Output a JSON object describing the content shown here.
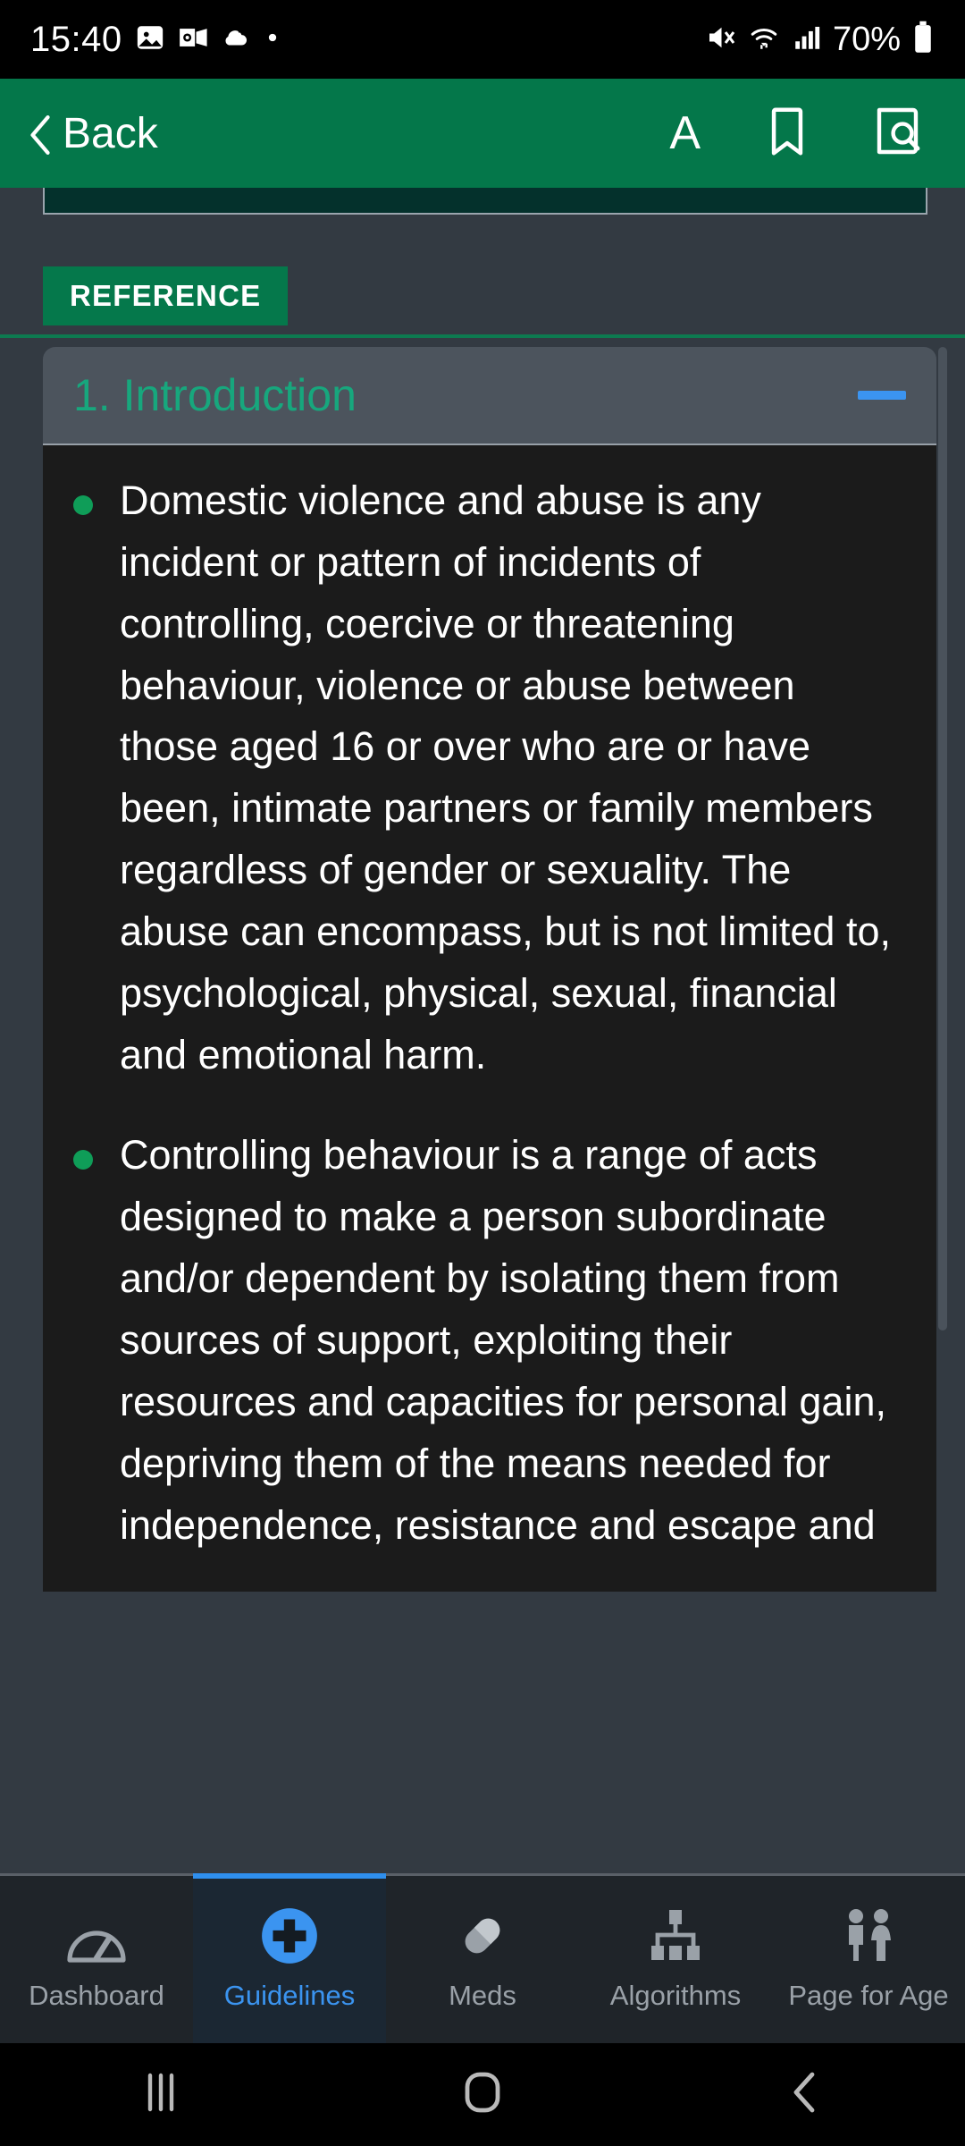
{
  "statusbar": {
    "time": "15:40",
    "battery_percent": "70%",
    "icons": [
      "photo-icon",
      "outlook-icon",
      "cloud-icon",
      "dot-icon"
    ],
    "right_icons": [
      "mute-icon",
      "wifi-icon",
      "signal-icon",
      "battery-icon"
    ]
  },
  "appbar": {
    "back_label": "Back",
    "background_color": "#04774a",
    "actions": [
      {
        "name": "font-size-icon",
        "label": "A"
      },
      {
        "name": "bookmark-icon",
        "label": ""
      },
      {
        "name": "page-search-icon",
        "label": ""
      }
    ]
  },
  "content": {
    "tab_badge": "REFERENCE",
    "accordion": {
      "title": "1. Introduction",
      "state": "expanded",
      "toggle_symbol": "minus",
      "toggle_color": "#3b94f0",
      "title_color": "#17a77d",
      "bullets": [
        "Domestic violence and abuse is any incident or pattern of incidents of controlling, coercive or threatening behaviour, violence or abuse between those aged 16 or over who are or have been, intimate partners or family members regardless of gender or sexuality. The abuse can encompass, but is not limited to, psychological, physical, sexual, financial and emotional harm.",
        "Controlling behaviour is a range of acts designed to make a person subordinate and/or dependent by isolating them from sources of support, exploiting their resources and capacities for personal gain, depriving them of the means needed for independence, resistance and escape and"
      ],
      "bullet_color": "#0f9d58"
    }
  },
  "bottomnav": {
    "active_index": 1,
    "active_color": "#3b94f0",
    "inactive_color": "#9aa1a8",
    "items": [
      {
        "label": "Dashboard",
        "icon": "gauge-icon"
      },
      {
        "label": "Guidelines",
        "icon": "medical-cross-icon"
      },
      {
        "label": "Meds",
        "icon": "pill-icon"
      },
      {
        "label": "Algorithms",
        "icon": "hierarchy-icon"
      },
      {
        "label": "Page for Age",
        "icon": "people-icon"
      }
    ]
  },
  "sysnav": {
    "buttons": [
      {
        "name": "recents-button",
        "icon": "three-bars-icon"
      },
      {
        "name": "home-button",
        "icon": "rounded-square-icon"
      },
      {
        "name": "back-button",
        "icon": "chevron-left-icon"
      }
    ]
  }
}
